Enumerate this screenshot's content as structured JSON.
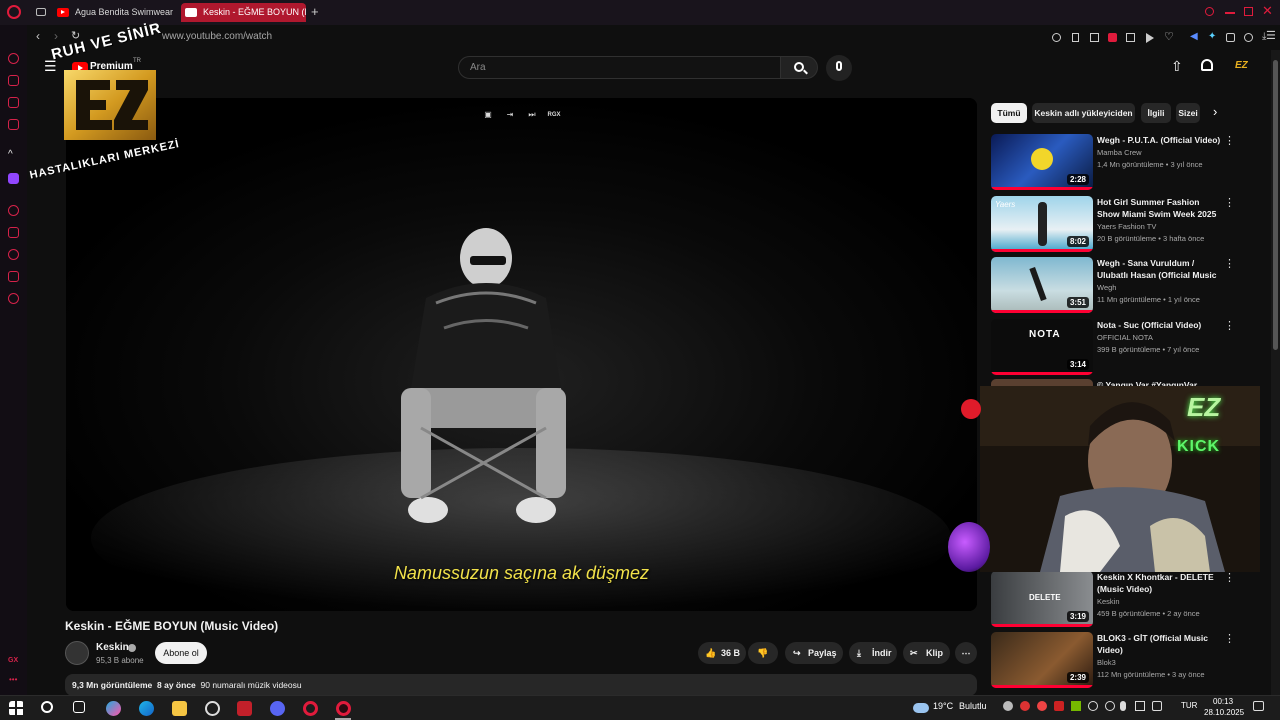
{
  "browser": {
    "tabs": [
      {
        "label": "Agua Bendita Swimwear f"
      },
      {
        "label": "Keskin - EĞME BOYUN (N"
      }
    ],
    "new_tab_label": "+",
    "url": "www.youtube.com/watch"
  },
  "youtube": {
    "premium_label": "Premium",
    "premium_region": "TR",
    "search_placeholder": "Ara",
    "player": {
      "subtitle": "Namussuzun saçına ak düşmez",
      "overlay_badge": "RGX"
    },
    "video": {
      "title": "Keskin - EĞME BOYUN (Music Video)",
      "channel": "Keskin",
      "subscribers": "95,3 B abone",
      "subscribe_label": "Abone ol",
      "likes": "36 B",
      "share_label": "Paylaş",
      "download_label": "İndir",
      "clip_label": "Klip",
      "views": "9,3 Mn görüntüleme",
      "age": "8 ay önce",
      "chart_rank": "90 numaralı müzik videosu"
    },
    "chips": [
      {
        "label": "Tümü"
      },
      {
        "label": "Keskin adlı yükleyiciden"
      },
      {
        "label": "İlgili"
      },
      {
        "label": "Sizei"
      }
    ],
    "recommendations": [
      {
        "title": "Wegh - P.U.T.A. (Official Video)",
        "channel": "Mamba Crew",
        "meta": "1,4 Mn görüntüleme • 3 yıl önce",
        "duration": "2:28"
      },
      {
        "title": "Hot Girl Summer Fashion Show Miami Swim Week 2025 Parai...",
        "channel": "Yaers Fashion TV",
        "meta": "20 B görüntüleme • 3 hafta önce",
        "duration": "8:02"
      },
      {
        "title": "Wegh -  Sana Vuruldum / Ulubatlı Hasan (Official Music ...",
        "channel": "Wegh",
        "meta": "11 Mn görüntüleme • 1 yıl önce",
        "duration": "3:51"
      },
      {
        "title": "Nota - Suc (Official Video)",
        "channel": "OFFICIAL NOTA",
        "meta": "399 B görüntüleme • 7 yıl önce",
        "duration": "3:14"
      },
      {
        "title": "© Yangın Var  #YangınVar",
        "channel": "",
        "meta": "",
        "duration": ""
      },
      {
        "title": "Keskin X Khontkar - DELETE (Music Video)",
        "channel": "Keskin",
        "meta": "459 B görüntüleme • 2 ay önce",
        "duration": "3:19"
      },
      {
        "title": "BLOK3 - GİT (Official Music Video)",
        "channel": "Blok3",
        "meta": "112 Mn görüntüleme • 3 ay önce",
        "duration": "2:39"
      }
    ],
    "thumb_labels": {
      "nota": "NOTA",
      "delete": "DELETE",
      "yaers": "Yaers"
    }
  },
  "overlays": {
    "logo_top_text": "RUH VE SİNİR",
    "logo_side_text": "HASTALIKLARI MERKEZİ",
    "logo_letters": "EZ",
    "webcam_logo": "EZ",
    "webcam_tag": "KICK"
  },
  "taskbar": {
    "temperature": "19°C",
    "condition": "Bulutlu",
    "language": "TUR",
    "time": "00:13",
    "date": "28.10.2025"
  },
  "sidebar_bottom_label": "GX",
  "colors": {
    "accent": "#b0182e",
    "opera_red": "#d6224a",
    "yt_red": "#ff0033",
    "subtitle": "#f2e24a"
  }
}
